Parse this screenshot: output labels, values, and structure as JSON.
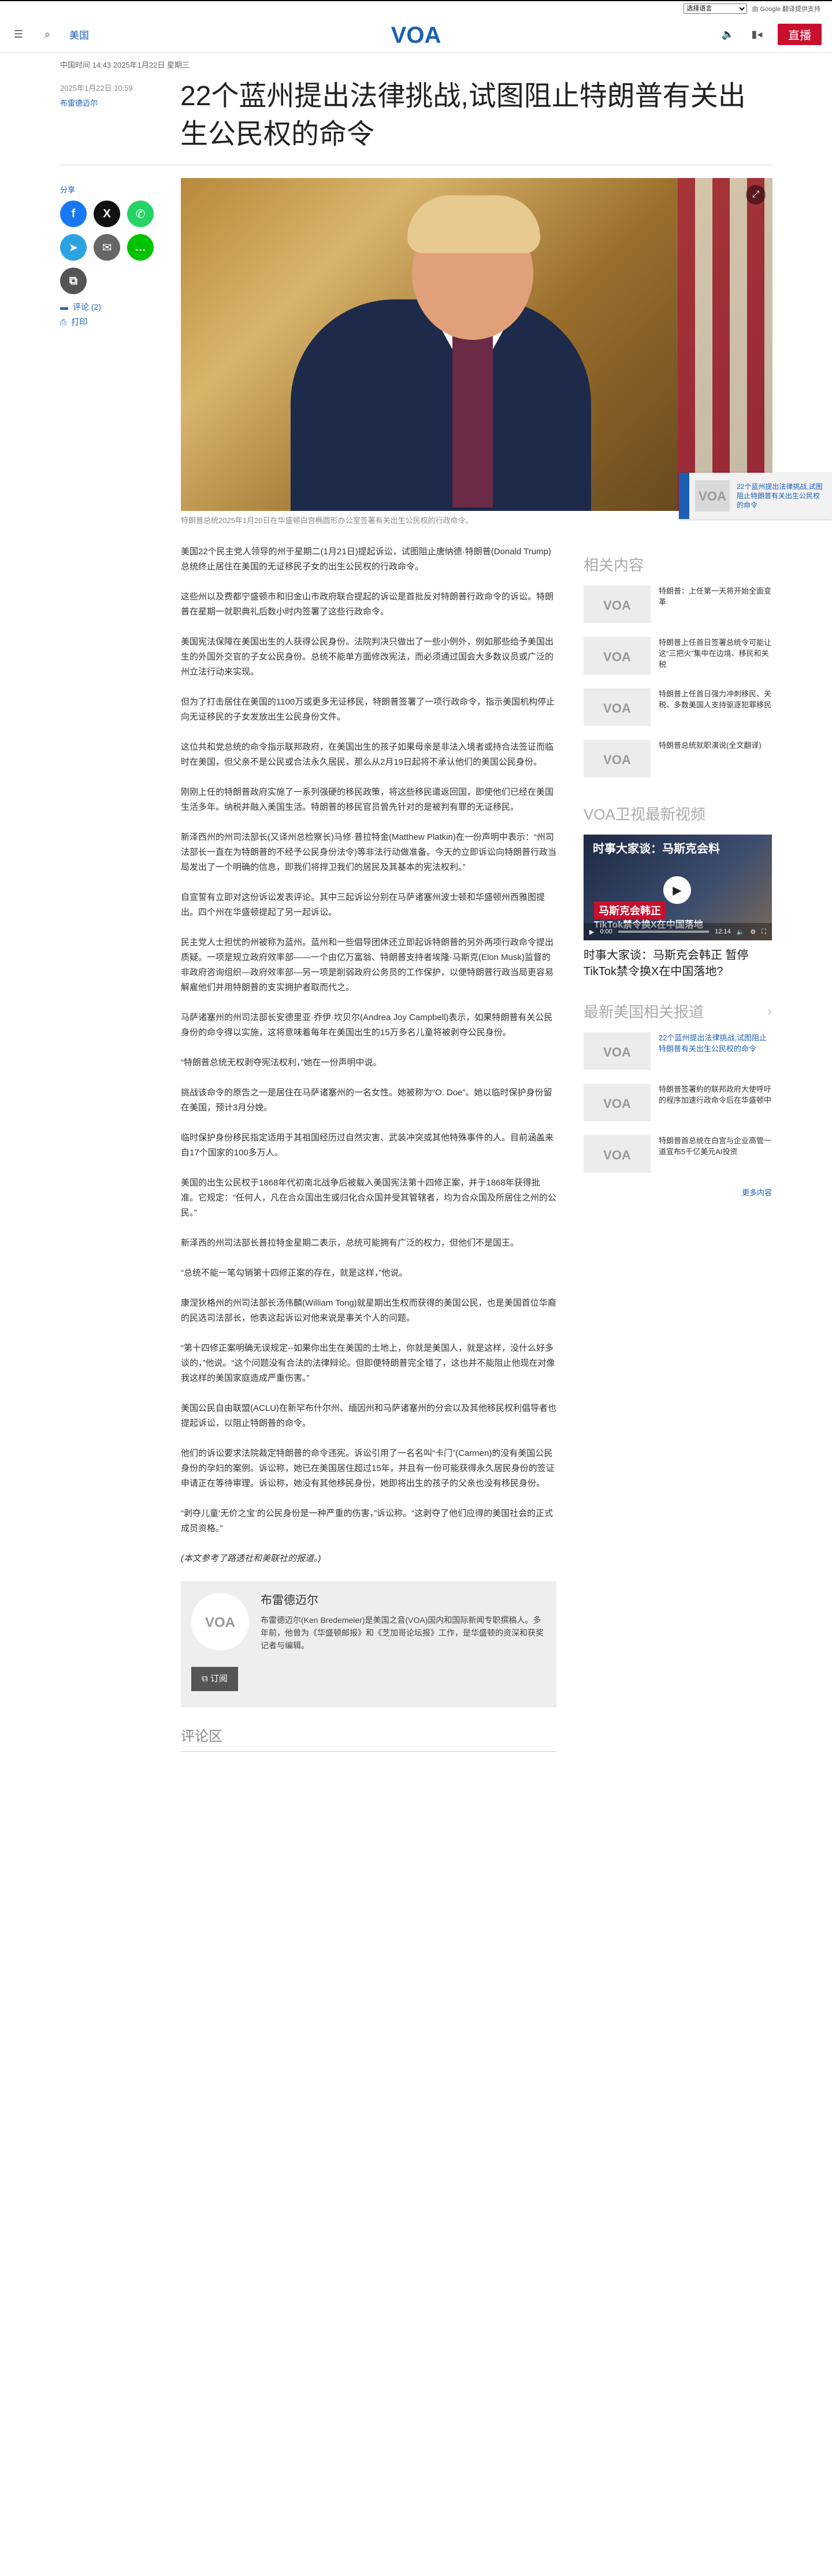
{
  "topbar": {
    "lang_select": "选择语言",
    "translate_label": "由 Google 翻译提供支持"
  },
  "header": {
    "section": "美国",
    "live_label": "直播"
  },
  "article": {
    "date_line": "中国时间 14:43 2025年1月22日 星期三",
    "published": "2025年1月22日 10:59",
    "byline": "布雷德迈尔",
    "title": "22个蓝州提出法律挑战,试图阻止特朗普有关出生公民权的命令",
    "caption": "特朗普总统2025年1月20日在华盛顿白宫椭圆形办公室签署有关出生公民权的行政命令。",
    "paragraphs": [
      "美国22个民主党人领导的州于星期二(1月21日)提起诉讼，试图阻止唐纳德·特朗普(Donald Trump)总统终止居住在美国的无证移民子女的出生公民权的行政命令。",
      "这些州以及费都宁盛顿市和旧金山市政府联合提起的诉讼是首批反对特朗普行政命令的诉讼。特朗普在星期一就职典礼后数小时内签署了这些行政命令。",
      "美国宪法保障在美国出生的人获得公民身份。法院判决只做出了一些小例外，例如那些给予美国出生的外国外交官的子女公民身份。总统不能单方面修改宪法，而必须通过国会大多数议员或广泛的州立法行动来实现。",
      "但为了打击居住在美国的1100万或更多无证移民，特朗普签署了一项行政命令，指示美国机构停止向无证移民的子女发放出生公民身份文件。",
      "这位共和党总统的命令指示联邦政府，在美国出生的孩子如果母亲是非法入境者或持合法签证而临时在美国，但父亲不是公民或合法永久居民，那么从2月19日起将不承认他们的美国公民身份。",
      "刚刚上任的特朗普政府实施了一系列强硬的移民政策，将这些移民遣返回国，即使他们已经在美国生活多年。纳税并融入美国生活。特朗普的移民官员曾先针对的是被判有罪的无证移民。",
      "新泽西州的州司法部长(又译州总检察长)马修·普拉特金(Matthew Platkin)在一份声明中表示：“州司法部长一直在为特朗普的不经予公民身份法令)等非法行动做准备。今天的立即诉讼向特朗普行政当局发出了一个明确的信息，即我们将捍卫我们的居民及其基本的宪法权利。”",
      "自宣誓有立即对这份诉讼发表评论。其中三起诉讼分别在马萨诸塞州波士顿和华盛顿州西雅图提出。四个州在华盛顿提起了另一起诉讼。",
      "民主党人士担忧的州被称为蓝州。蓝州和一些倡导团体还立即起诉特朗普的另外两项行政命令提出质疑。一项是规立政府效率部——一个由亿万富翁、特朗普支持者埃隆·马斯克(Elon Musk)监督的非政府咨询组织—政府效率部—另一项是削弱政府公务员的工作保护，以便特朗普行政当局更容易解雇他们并用特朗普的支实拥护者取而代之。",
      "马萨诸塞州的州司法部长安德里亚·乔伊·坎贝尔(Andrea Joy Campbell)表示，如果特朗普有关公民身份的命令得以实施，这将意味着每年在美国出生的15万多名儿童将被剥夺公民身份。",
      "“特朗普总统无权剥夺宪法权利，”她在一份声明中说。",
      "挑战该命令的原告之一是居住在马萨诸塞州的一名女性。她被称为“O. Doe”。她以临时保护身份留在美国，预计3月分娩。",
      "临时保护身份移民指定适用于其祖国经历过自然灾害、武装冲突或其他特殊事件的人。目前涵盖来自17个国家的100多万人。",
      "美国的出生公民权于1868年代初南北战争后被载入美国宪法第十四修正案，并于1868年获得批准。它规定：“任何人，凡在合众国出生或归化合众国并受其管辖者，均为合众国及所居住之州的公民。”",
      "新泽西的州司法部长普拉特金星期二表示，总统可能拥有广泛的权力，但他们不是国王。",
      "“总统不能一笔勾销第十四修正案的存在，就是这样，”他说。",
      "康涅狄格州的州司法部长汤伟麟(William Tong)就星期出生权而获得的美国公民，也是美国首位华裔的民选司法部长，他表这起诉讼对他来说是事关个人的问题。",
      "“第十四修正案明确无误规定--如果你出生在美国的土地上，你就是美国人，就是这样，没什么好多谈的，”他说。“这个问题没有合法的法律辩论。但即便特朗普完全错了，这也并不能阻止他现在对像我这样的美国家庭造成严重伤害。”",
      "美国公民自由联盟(ACLU)在新罕布什尔州、缅因州和马萨诸塞州的分会以及其他移民权利倡导者也提起诉讼，以阻止特朗普的命令。",
      "他们的诉讼要求法院裁定特朗普的命令违宪。诉讼引用了一名名叫“卡门”(Carmen)的没有美国公民身份的孕妇的案例。诉讼称，她已在美国居住超过15年，并且有一份可能获得永久居民身份的签证申请正在等待审理。诉讼称，她没有其他移民身份，她即将出生的孩子的父亲也没有移民身份。",
      "“剥夺儿童‘无价之宝’的公民身份是一种严重的伤害，”诉讼称。“这剥夺了他们应得的美国社会的正式成员资格。”"
    ],
    "note": "(本文参考了路透社和美联社的报道。)"
  },
  "share": {
    "label": "分享",
    "comments": "评论 (2)",
    "print": "打印"
  },
  "popup": {
    "text": "22个蓝州提出法律挑战,试图阻止特朗普有关出生公民权的命令"
  },
  "author": {
    "name": "布雷德迈尔",
    "bio": "布雷德迈尔(Ken Bredemeier)是美国之音(VOA)国内和国际新闻专职撰稿人。多年前，他曾为《华盛顿邮报》和《芝加哥论坛报》工作，是华盛顿的资深和获奖记者与编辑。",
    "subscribe": "订阅"
  },
  "comments_title": "评论区",
  "sidebar": {
    "related_title": "相关内容",
    "related": [
      "特朗普：上任第一天将开始全面变革",
      "特朗普上任首日签署总统令可能让这“三把火”集中在边境、移民和关税",
      "特朗普上任首日强力冲刺移民、关税、多数美国人支持驱逐犯罪移民",
      "特朗普总统就职演说(全文翻译)"
    ],
    "video_section_title": "VOA卫视最新视频",
    "video": {
      "overlay_title": "时事大家谈：马斯克会料",
      "overlay_red": "马斯克会韩正",
      "overlay_sub": "TikTok禁令换X在中国落地",
      "time_current": "0:00",
      "time_total": "12:14",
      "title": "时事大家谈：马斯克会韩正 暂停TikTok禁令换X在中国落地?"
    },
    "latest_title": "最新美国相关报道",
    "latest": [
      "22个蓝州提出法律挑战,试图阻止特朗普有关出生公民权的命令",
      "特朗普签署約的联邦政府大使呼吁的程序加速行政命令后在华盛顿中",
      "特朗普首总统在白宫与企业高管一道宣布5千亿美元AI投资"
    ],
    "more": "更多内容"
  }
}
